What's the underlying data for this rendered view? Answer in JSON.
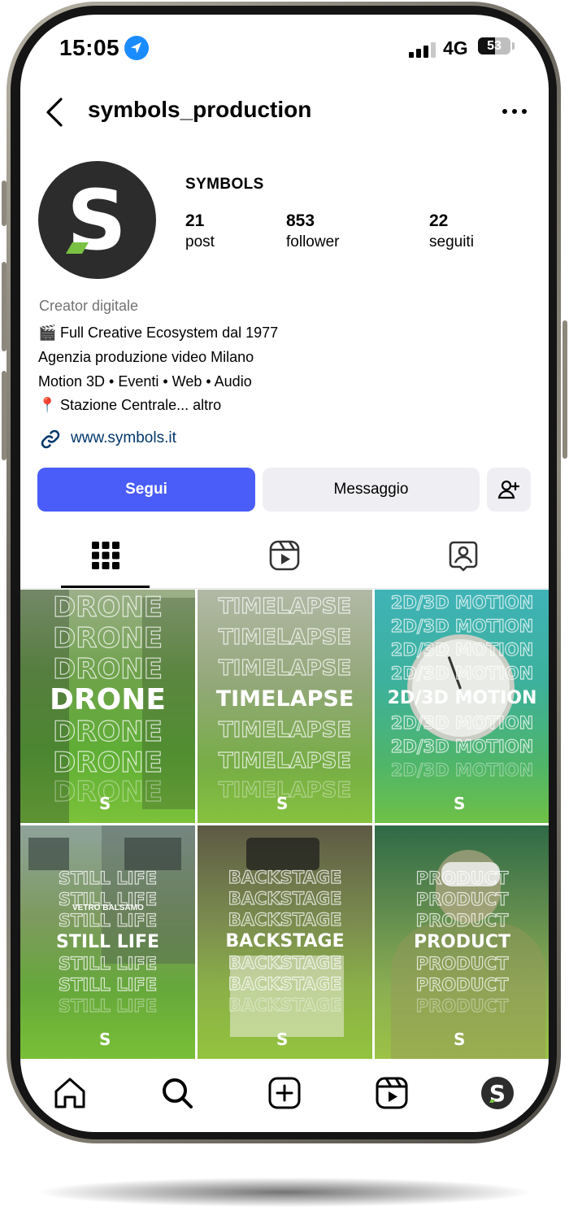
{
  "status_bar": {
    "time": "15:05",
    "network": "4G",
    "battery": "53",
    "battery_level": 0.53,
    "signal_bars": 3
  },
  "header": {
    "username": "symbols_production",
    "back_icon": "chevron-left-icon",
    "more_icon": "ellipsis-icon"
  },
  "profile": {
    "name": "SYMBOLS",
    "stats": [
      {
        "value": "21",
        "label": "post"
      },
      {
        "value": "853",
        "label": "follower"
      },
      {
        "value": "22",
        "label": "seguiti"
      }
    ],
    "category": "Creator digitale",
    "bio": [
      {
        "emoji": "🎬",
        "text": "Full Creative Ecosystem dal 1977"
      },
      {
        "emoji": "",
        "text": "Agenzia produzione video Milano"
      },
      {
        "emoji": "",
        "text": "Motion 3D • Eventi • Web • Audio"
      },
      {
        "emoji": "📍",
        "text": "Stazione Centrale... altro"
      }
    ],
    "link": "www.symbols.it"
  },
  "buttons": {
    "follow": "Segui",
    "message": "Messaggio",
    "add_person_icon": "add-person-icon"
  },
  "tabs": [
    {
      "name": "grid",
      "icon": "grid-icon",
      "active": true
    },
    {
      "name": "reels",
      "icon": "reels-icon",
      "active": false
    },
    {
      "name": "tagged",
      "icon": "tagged-user-icon",
      "active": false
    }
  ],
  "posts": [
    {
      "word": "DRONE",
      "extra": ""
    },
    {
      "word": "TIMELAPSE",
      "extra": ""
    },
    {
      "word": "2D/3D MOTION",
      "extra": ""
    },
    {
      "word": "STILL LIFE",
      "extra": "VETRO BALSAMO"
    },
    {
      "word": "BACKSTAGE",
      "extra": ""
    },
    {
      "word": "PRODUCT",
      "extra": ""
    }
  ],
  "brand_mark": "S",
  "colors": {
    "accent": "#4a5df9",
    "link": "#00376b",
    "brand_green": "#7ac143",
    "avatar_bg": "#2c2c2c"
  },
  "bottom_nav": [
    {
      "name": "home",
      "icon": "home-icon"
    },
    {
      "name": "search",
      "icon": "search-icon"
    },
    {
      "name": "create",
      "icon": "plus-square-icon"
    },
    {
      "name": "reels",
      "icon": "reels-icon"
    },
    {
      "name": "profile",
      "icon": "profile-avatar"
    }
  ]
}
